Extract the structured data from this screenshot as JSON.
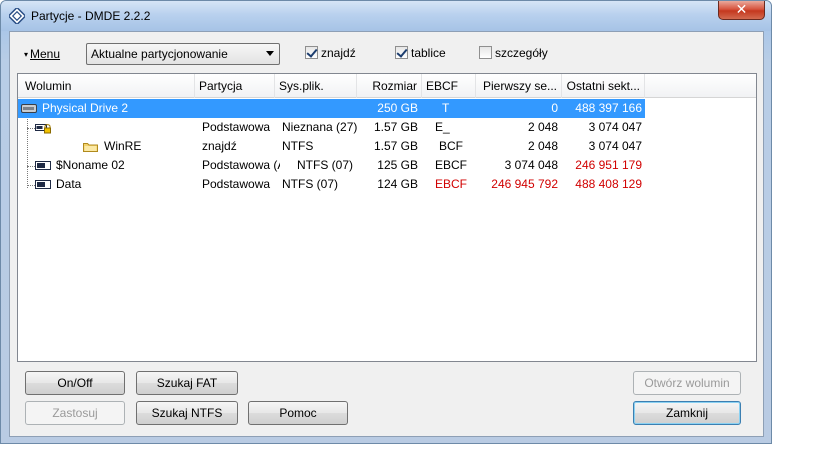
{
  "window": {
    "title": "Partycje - DMDE 2.2.2",
    "close_glyph": "✕"
  },
  "toolbar": {
    "menu_arrow": "▾",
    "menu_label": "Menu",
    "mode_select": "Aktualne partycjonowanie",
    "checkboxes": [
      {
        "label": "znajdź",
        "checked": true
      },
      {
        "label": "tablice",
        "checked": true
      },
      {
        "label": "szczegóły",
        "checked": false
      }
    ]
  },
  "table": {
    "columns": [
      "Wolumin",
      "Partycja",
      "Sys.plik.",
      "Rozmiar",
      "EBCF",
      "Pierwszy se...",
      "Ostatni sekt..."
    ],
    "rows": [
      {
        "volume": "Physical Drive 2",
        "partition": "",
        "fs": "",
        "size": "250 GB",
        "ebcf": "T",
        "first": "0",
        "last": "488 397 166",
        "icon": "drive-icon",
        "selected": true,
        "red_ebcf": false,
        "red_first": false,
        "red_last": false
      },
      {
        "volume": "",
        "partition": "Podstawowa",
        "fs": "Nieznana (27)",
        "size": "1.57 GB",
        "ebcf": "E_",
        "first": "2 048",
        "last": "3 074 047",
        "icon": "locked-partition-icon",
        "selected": false,
        "red_ebcf": false,
        "red_first": false,
        "red_last": false
      },
      {
        "volume": "WinRE",
        "partition": "znajdź",
        "fs": "NTFS",
        "size": "1.57 GB",
        "ebcf": "BCF",
        "first": "2 048",
        "last": "3 074 047",
        "icon": "folder-icon",
        "selected": false,
        "red_ebcf": false,
        "red_first": false,
        "red_last": false
      },
      {
        "volume": "$Noname 02",
        "partition": "Podstawowa (A)",
        "fs": "NTFS (07)",
        "size": "125 GB",
        "ebcf": "EBCF",
        "first": "3 074 048",
        "last": "246 951 179",
        "icon": "partition-icon",
        "selected": false,
        "red_ebcf": false,
        "red_first": false,
        "red_last": true
      },
      {
        "volume": "Data",
        "partition": "Podstawowa",
        "fs": "NTFS (07)",
        "size": "124 GB",
        "ebcf": "EBCF",
        "first": "246 945 792",
        "last": "488 408 129",
        "icon": "partition-icon",
        "selected": false,
        "red_ebcf": true,
        "red_first": true,
        "red_last": true
      }
    ]
  },
  "buttons": {
    "onoff": "On/Off",
    "szukaj_fat": "Szukaj FAT",
    "zastosuj": "Zastosuj",
    "szukaj_ntfs": "Szukaj NTFS",
    "pomoc": "Pomoc",
    "otworz": "Otwórz wolumin",
    "zamknij": "Zamknij"
  },
  "colors": {
    "selection": "#3399ff",
    "highlight_red": "#d10000",
    "frame": "#aac6e8"
  }
}
